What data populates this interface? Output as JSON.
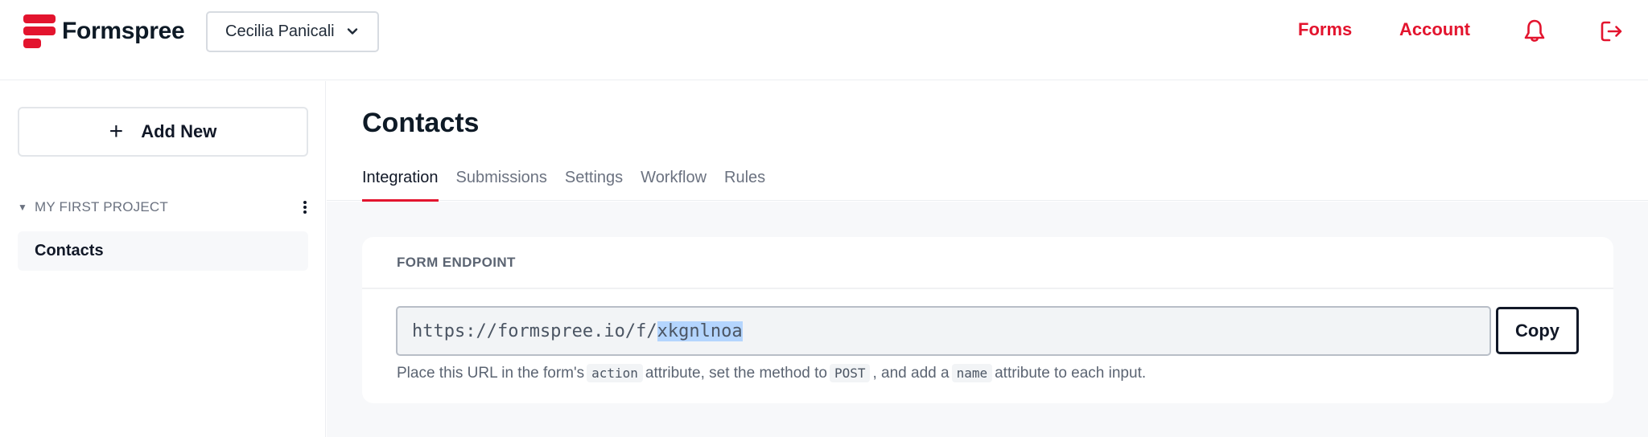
{
  "header": {
    "brand": "Formspree",
    "account_selector": "Cecilia Panicali",
    "nav": [
      {
        "label": "Forms"
      },
      {
        "label": "Account"
      }
    ],
    "icons": [
      "bell-icon",
      "logout-icon"
    ],
    "accent_color": "#e3142e"
  },
  "sidebar": {
    "add_new_label": "Add New",
    "project": {
      "name": "MY FIRST PROJECT",
      "forms": [
        {
          "label": "Contacts",
          "selected": true
        }
      ]
    }
  },
  "main": {
    "title": "Contacts",
    "tabs": [
      {
        "label": "Integration",
        "active": true
      },
      {
        "label": "Submissions",
        "active": false
      },
      {
        "label": "Settings",
        "active": false
      },
      {
        "label": "Workflow",
        "active": false
      },
      {
        "label": "Rules",
        "active": false
      }
    ],
    "endpoint_card": {
      "heading": "FORM ENDPOINT",
      "url_prefix": "https://formspree.io/f/",
      "url_selected_part": "xkgnlnoa",
      "copy_label": "Copy",
      "help": {
        "t1": "Place this URL in the form's",
        "c1": "action",
        "t2": "attribute, set the method to",
        "c2": "POST",
        "t3": ", and add a",
        "c3": "name",
        "t4": "attribute to each input."
      }
    }
  }
}
